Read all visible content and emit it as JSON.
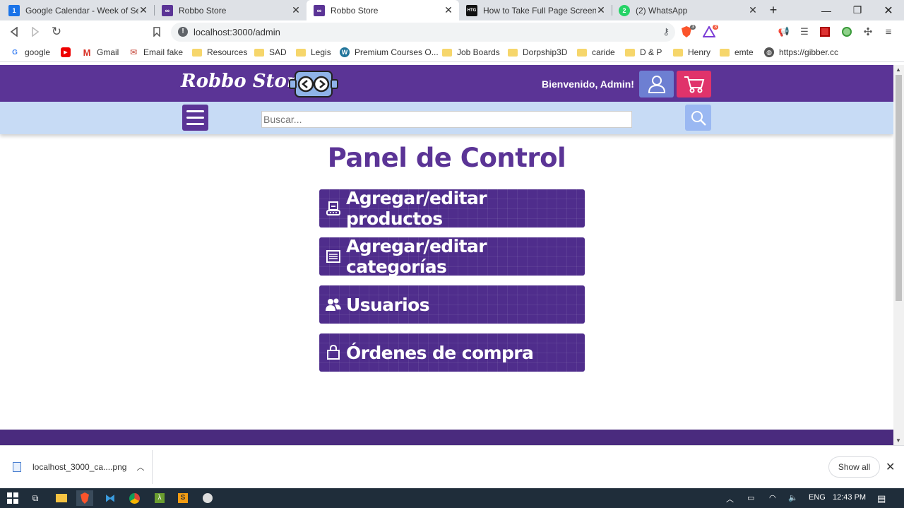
{
  "browser": {
    "tabs": [
      {
        "title": "Google Calendar - Week of Sept",
        "favicon": "calendar-icon",
        "fav_text": "1",
        "fav_color": "#1a73e8"
      },
      {
        "title": "Robbo Store",
        "favicon": "robot-icon",
        "fav_text": "",
        "fav_color": "#5b3496"
      },
      {
        "title": "Robbo Store",
        "favicon": "robot-icon",
        "fav_text": "",
        "fav_color": "#5b3496"
      },
      {
        "title": "How to Take Full Page Screensho",
        "favicon": "htg-icon",
        "fav_text": "HTG",
        "fav_color": "#111111"
      },
      {
        "title": "(2) WhatsApp",
        "favicon": "whatsapp-icon",
        "fav_text": "2",
        "fav_color": "#25d366"
      }
    ],
    "active_tab": 2,
    "url": "localhost:3000/admin",
    "extension_badges": {
      "brave_shields": "3",
      "brave_rewards": "3"
    },
    "bookmarks": [
      {
        "label": "google",
        "icon": "google-icon"
      },
      {
        "label": "",
        "icon": "youtube-icon"
      },
      {
        "label": "Gmail",
        "icon": "gmail-icon"
      },
      {
        "label": "Email fake",
        "icon": "mail-icon"
      },
      {
        "label": "Resources",
        "icon": "folder-icon"
      },
      {
        "label": "SAD",
        "icon": "folder-icon"
      },
      {
        "label": "Legis",
        "icon": "folder-icon"
      },
      {
        "label": "Premium Courses O...",
        "icon": "wordpress-icon"
      },
      {
        "label": "Job Boards",
        "icon": "folder-icon"
      },
      {
        "label": "Dorpship3D",
        "icon": "folder-icon"
      },
      {
        "label": "caride",
        "icon": "folder-icon"
      },
      {
        "label": "D & P",
        "icon": "folder-icon"
      },
      {
        "label": "Henry",
        "icon": "folder-icon"
      },
      {
        "label": "emte",
        "icon": "folder-icon"
      },
      {
        "label": "https://gibber.cc",
        "icon": "globe-icon"
      }
    ]
  },
  "site": {
    "brand": "Robbo Store",
    "welcome": "Bienvenido, Admin!",
    "search_placeholder": "Buscar...",
    "colors": {
      "primary": "#5b3496",
      "searchbar": "#c7dbf5",
      "cart": "#e0336b",
      "user": "#6d7fd2"
    }
  },
  "admin": {
    "title": "Panel de Control",
    "buttons": [
      {
        "label": "Agregar/editar productos",
        "icon": "product-icon"
      },
      {
        "label": "Agregar/editar categorías",
        "icon": "list-icon"
      },
      {
        "label": "Usuarios",
        "icon": "users-icon"
      },
      {
        "label": "Órdenes de compra",
        "icon": "bag-icon"
      }
    ]
  },
  "downloads": {
    "file": "localhost_3000_ca....png",
    "show_all": "Show all"
  },
  "taskbar": {
    "language": "ENG",
    "time": "12:43 PM"
  }
}
